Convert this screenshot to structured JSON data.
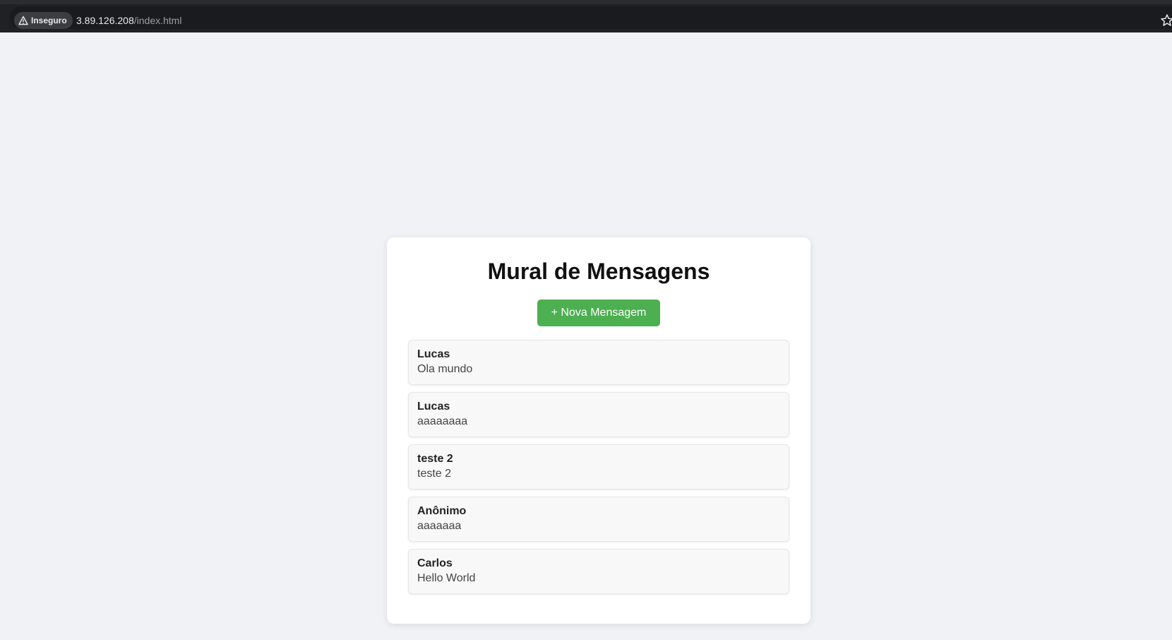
{
  "browser": {
    "security_label": "Inseguro",
    "url_host": "3.89.126.208",
    "url_path": "/index.html",
    "icons": [
      "warning-icon",
      "star-icon"
    ]
  },
  "page": {
    "title": "Mural de Mensagens",
    "new_button_label": "+ Nova Mensagem",
    "colors": {
      "background": "#f0f2f5",
      "card": "#ffffff",
      "accent": "#4caf50"
    }
  },
  "messages": [
    {
      "author": "Lucas",
      "text": "Ola mundo"
    },
    {
      "author": "Lucas",
      "text": "aaaaaaaa"
    },
    {
      "author": "teste 2",
      "text": "teste 2"
    },
    {
      "author": "Anônimo",
      "text": "aaaaaaa"
    },
    {
      "author": "Carlos",
      "text": "Hello World"
    }
  ]
}
